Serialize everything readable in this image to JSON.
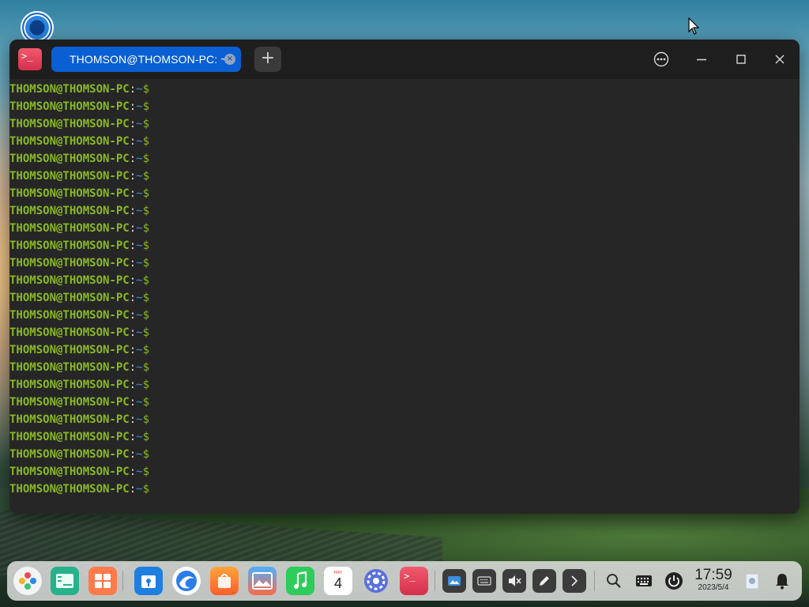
{
  "desktop": {
    "launcher_icon": "deepin-logo-icon",
    "cursor_icon": "mouse-pointer-icon"
  },
  "terminal": {
    "app_icon": "terminal-app-icon",
    "tab": {
      "label": "THOMSON@THOMSON-PC: ~",
      "close_icon": "close-icon"
    },
    "new_tab_label": "+",
    "window_buttons": [
      "more-options-icon",
      "minimize-icon",
      "maximize-icon",
      "close-icon"
    ],
    "lines": [
      {
        "user": "THOMSON@THOMSON-PC",
        "sep": ":",
        "path": "~",
        "dollar": "$"
      },
      {
        "user": "THOMSON@THOMSON-PC",
        "sep": ":",
        "path": "~",
        "dollar": "$"
      },
      {
        "user": "THOMSON@THOMSON-PC",
        "sep": ":",
        "path": "~",
        "dollar": "$"
      },
      {
        "user": "THOMSON@THOMSON-PC",
        "sep": ":",
        "path": "~",
        "dollar": "$"
      },
      {
        "user": "THOMSON@THOMSON-PC",
        "sep": ":",
        "path": "~",
        "dollar": "$"
      },
      {
        "user": "THOMSON@THOMSON-PC",
        "sep": ":",
        "path": "~",
        "dollar": "$"
      },
      {
        "user": "THOMSON@THOMSON-PC",
        "sep": ":",
        "path": "~",
        "dollar": "$"
      },
      {
        "user": "THOMSON@THOMSON-PC",
        "sep": ":",
        "path": "~",
        "dollar": "$"
      },
      {
        "user": "THOMSON@THOMSON-PC",
        "sep": ":",
        "path": "~",
        "dollar": "$"
      },
      {
        "user": "THOMSON@THOMSON-PC",
        "sep": ":",
        "path": "~",
        "dollar": "$"
      },
      {
        "user": "THOMSON@THOMSON-PC",
        "sep": ":",
        "path": "~",
        "dollar": "$"
      },
      {
        "user": "THOMSON@THOMSON-PC",
        "sep": ":",
        "path": "~",
        "dollar": "$"
      },
      {
        "user": "THOMSON@THOMSON-PC",
        "sep": ":",
        "path": "~",
        "dollar": "$"
      },
      {
        "user": "THOMSON@THOMSON-PC",
        "sep": ":",
        "path": "~",
        "dollar": "$"
      },
      {
        "user": "THOMSON@THOMSON-PC",
        "sep": ":",
        "path": "~",
        "dollar": "$"
      },
      {
        "user": "THOMSON@THOMSON-PC",
        "sep": ":",
        "path": "~",
        "dollar": "$"
      },
      {
        "user": "THOMSON@THOMSON-PC",
        "sep": ":",
        "path": "~",
        "dollar": "$"
      },
      {
        "user": "THOMSON@THOMSON-PC",
        "sep": ":",
        "path": "~",
        "dollar": "$"
      },
      {
        "user": "THOMSON@THOMSON-PC",
        "sep": ":",
        "path": "~",
        "dollar": "$"
      },
      {
        "user": "THOMSON@THOMSON-PC",
        "sep": ":",
        "path": "~",
        "dollar": "$"
      },
      {
        "user": "THOMSON@THOMSON-PC",
        "sep": ":",
        "path": "~",
        "dollar": "$"
      },
      {
        "user": "THOMSON@THOMSON-PC",
        "sep": ":",
        "path": "~",
        "dollar": "$"
      },
      {
        "user": "THOMSON@THOMSON-PC",
        "sep": ":",
        "path": "~",
        "dollar": "$"
      },
      {
        "user": "THOMSON@THOMSON-PC",
        "sep": ":",
        "path": "~",
        "dollar": "$"
      }
    ],
    "colors": {
      "user": "#8ab823",
      "path": "#2f8fe8",
      "background": "#262626",
      "tab": "#0a5fd3"
    }
  },
  "dock": {
    "apps": [
      "launcher-icon",
      "file-manager-icon",
      "multitasking-icon",
      "app-store-icon",
      "browser-icon",
      "app-market-icon",
      "image-viewer-icon",
      "music-icon",
      "calendar-icon",
      "control-center-icon",
      "terminal-icon"
    ],
    "calendar_day": "4",
    "calendar_month": "MAY",
    "tray": [
      "screenshot-icon",
      "onboard-keyboard-icon",
      "volume-muted-icon",
      "pen-icon",
      "expand-chevron-icon"
    ],
    "system": [
      "search-icon",
      "keyboard-icon",
      "power-icon"
    ],
    "clock": {
      "time": "17:59",
      "date": "2023/5/4"
    },
    "trash_icon": "trash-icon",
    "notification_icon": "notification-bell-icon"
  }
}
